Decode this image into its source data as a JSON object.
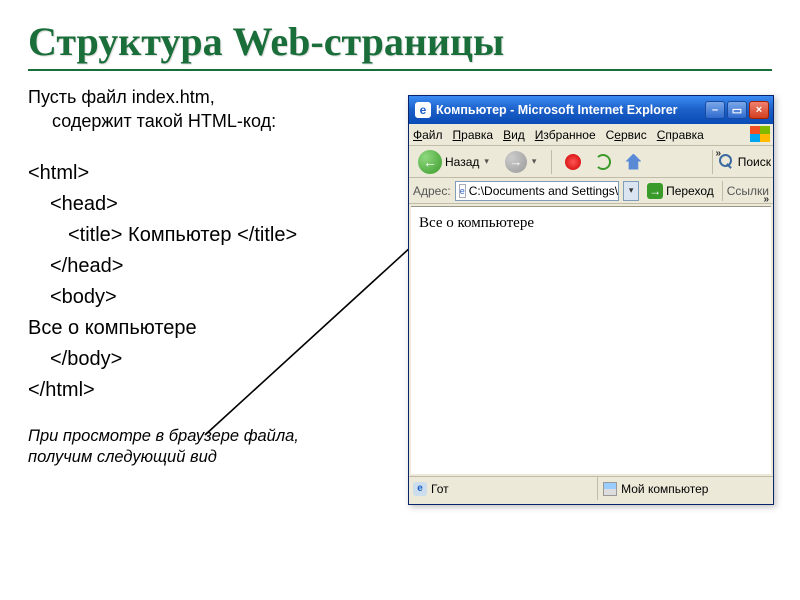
{
  "title": "Структура Web-страницы",
  "intro_line1": "Пусть файл index.htm,",
  "intro_line2": "содержит такой HTML-код:",
  "code": {
    "l1": "<html>",
    "l2": "<head>",
    "l3": "<title> Компьютер </title>",
    "l4": "</head>",
    "l5": "<body>",
    "l6": "Все о компьютере",
    "l7": "</body>",
    "l8": "</html>"
  },
  "footnote_l1": "При просмотре в браузере файла,",
  "footnote_l2": "получим следующий вид",
  "browser": {
    "window_title": "Компьютер - Microsoft Internet Explorer",
    "menu": {
      "file": "Файл",
      "edit": "Правка",
      "view": "Вид",
      "favorites": "Избранное",
      "tools": "Сервис",
      "help": "Справка"
    },
    "toolbar": {
      "back": "Назад",
      "search": "Поиск"
    },
    "address_label": "Адрес:",
    "address_value": "C:\\Documents and Settings\\",
    "go_label": "Переход",
    "links_label": "Ссылки",
    "page_content": "Все о компьютере",
    "status_left": "Гот",
    "status_right": "Мой компьютер"
  }
}
